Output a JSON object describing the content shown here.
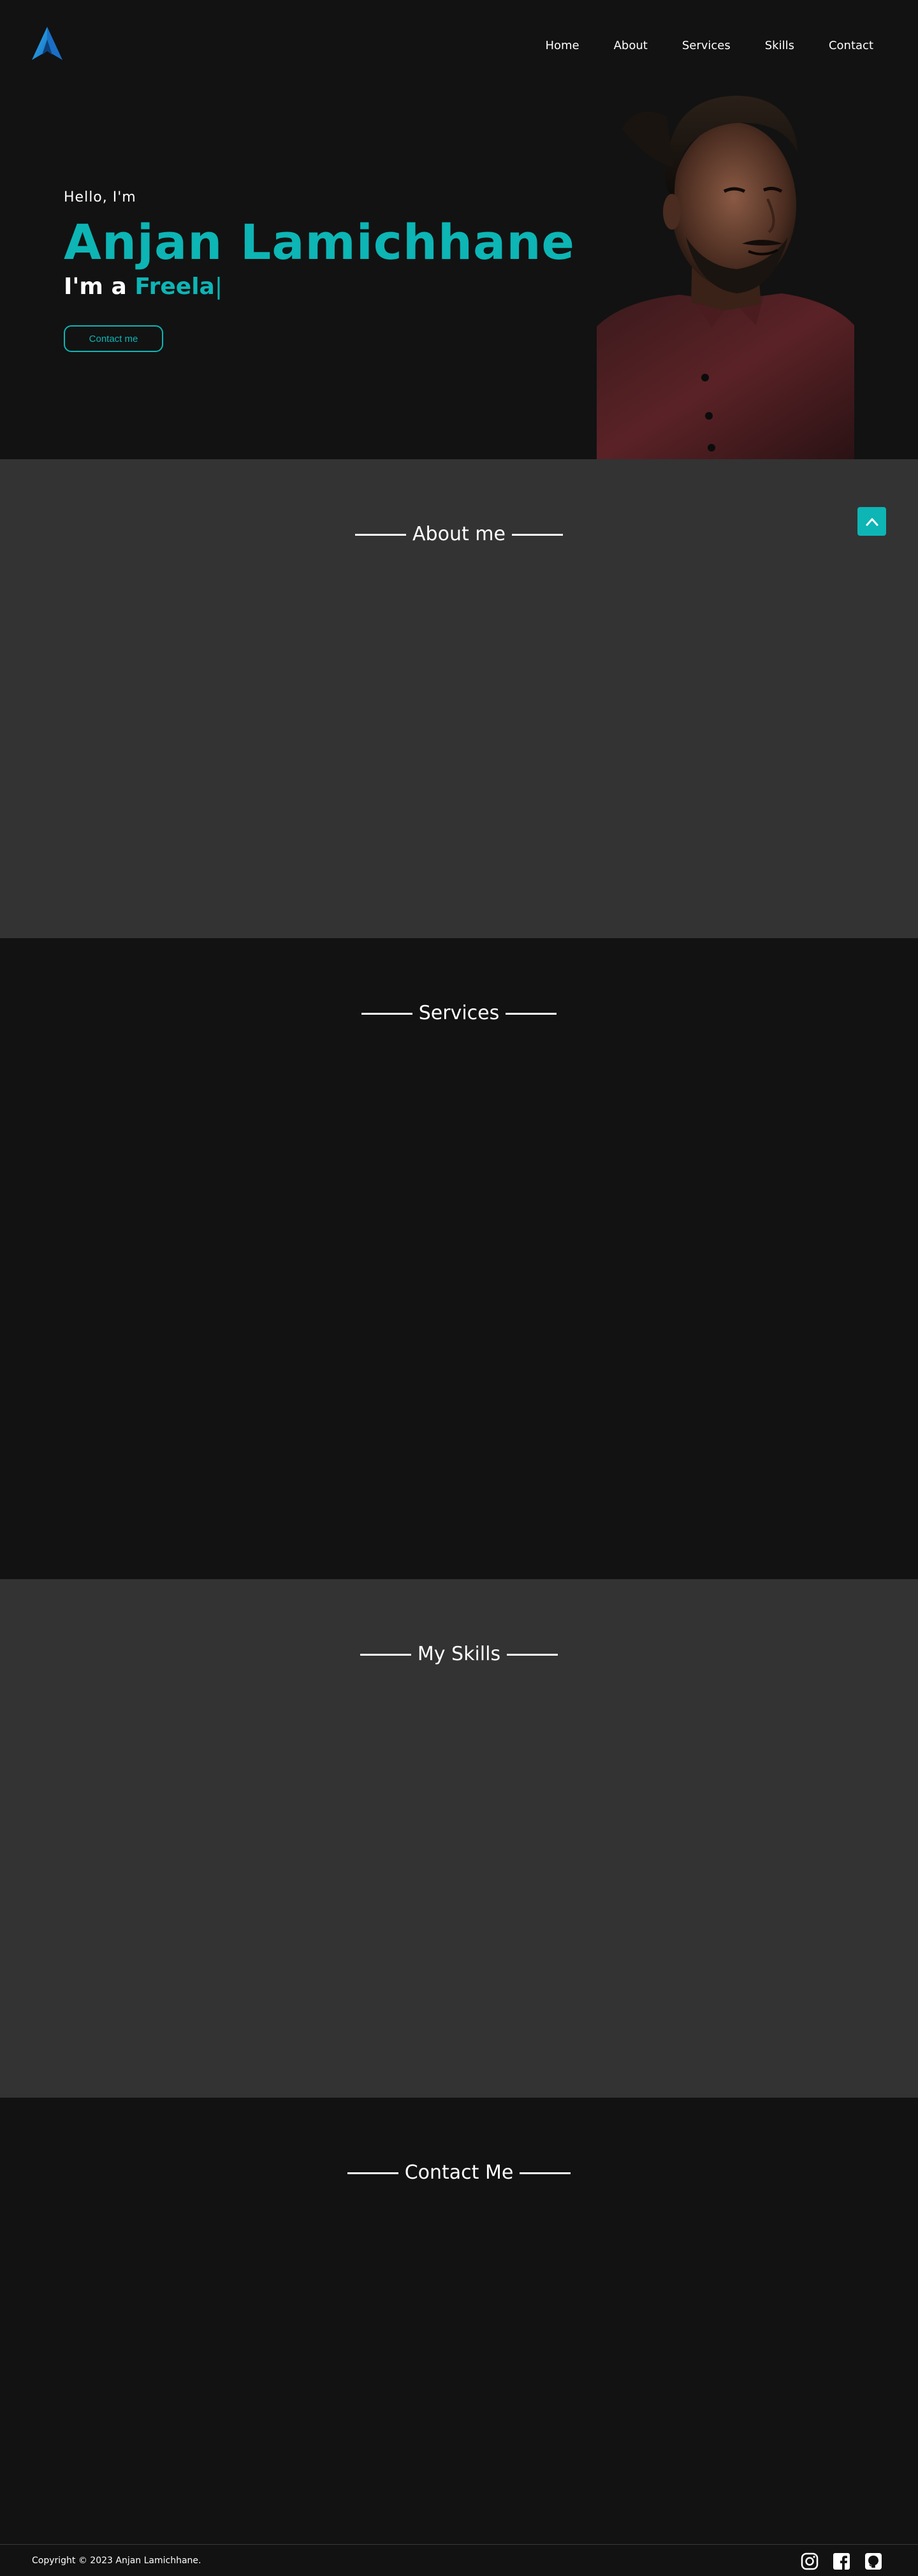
{
  "nav": {
    "items": [
      {
        "label": "Home"
      },
      {
        "label": "About"
      },
      {
        "label": "Services"
      },
      {
        "label": "Skills"
      },
      {
        "label": "Contact"
      }
    ]
  },
  "hero": {
    "greeting": "Hello, I'm",
    "name": "Anjan Lamichhane",
    "role_prefix": "I'm a",
    "role_typed": "Freela",
    "caret": "|",
    "contact_button": "Contact me"
  },
  "sections": {
    "about": {
      "title": "About me"
    },
    "services": {
      "title": "Services"
    },
    "skills": {
      "title": "My Skills"
    },
    "contact": {
      "title": "Contact Me"
    }
  },
  "footer": {
    "copyright": "Copyright © 2023 Anjan Lamichhane.",
    "socials": [
      {
        "icon": "instagram-icon"
      },
      {
        "icon": "facebook-icon"
      },
      {
        "icon": "github-icon"
      }
    ]
  },
  "colors": {
    "accent": "#0db5b5",
    "background_dark": "#121212",
    "background_gray": "#333333",
    "text": "#ffffff"
  },
  "icons": {
    "logo": "logo-a-icon",
    "scroll_top": "chevron-up-icon"
  }
}
